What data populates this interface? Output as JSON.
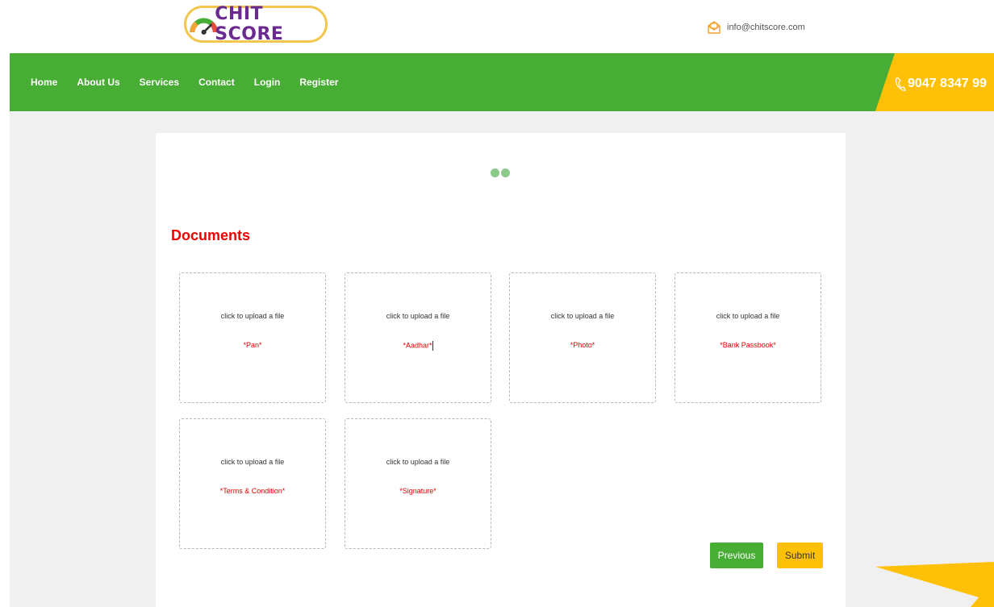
{
  "header": {
    "logo_text": "CHIT SCORE",
    "email": "info@chitscore.com",
    "phone": "9047 8347 99"
  },
  "nav": {
    "items": [
      "Home",
      "About Us",
      "Services",
      "Contact",
      "Login",
      "Register"
    ]
  },
  "documents": {
    "title": "Documents",
    "upload_hint": "click to upload a file",
    "fields": [
      "*Pan*",
      "*Aadhar*",
      "*Photo*",
      "*Bank Passbook*",
      "*Terms & Condition*",
      "*Signature*"
    ]
  },
  "actions": {
    "previous": "Previous",
    "submit": "Submit"
  },
  "colors": {
    "brand_green": "#48ad34",
    "accent_yellow": "#ffc107",
    "required_red": "#e00000",
    "title_red": "#f00000"
  }
}
